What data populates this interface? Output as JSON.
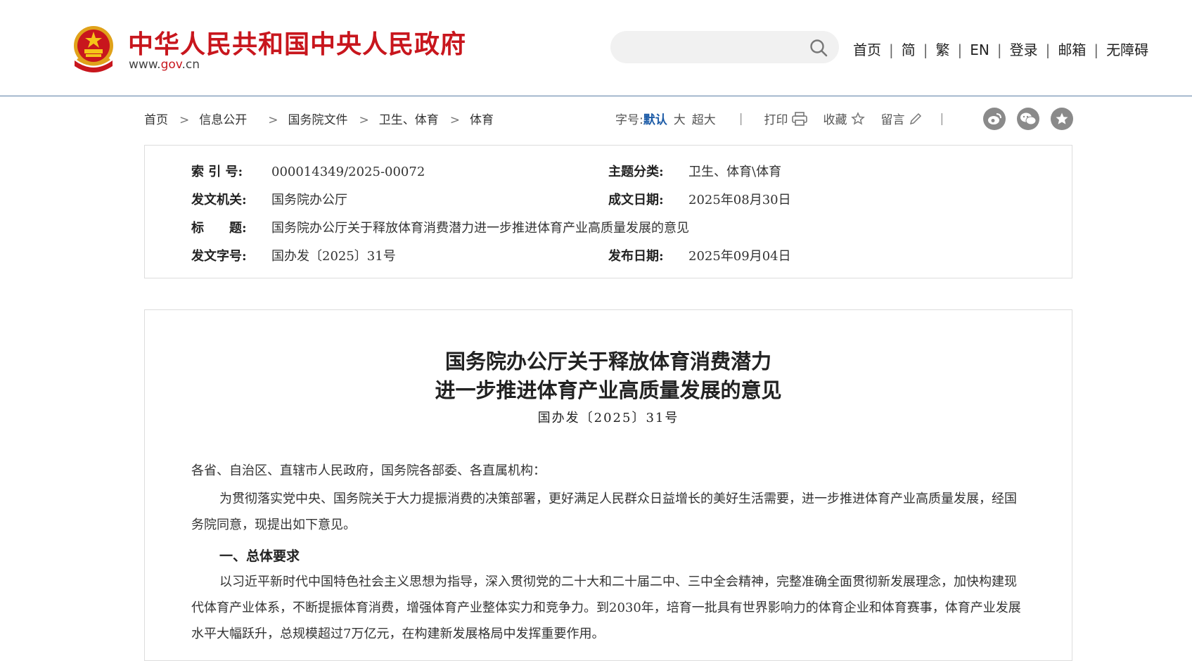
{
  "header": {
    "site_title": "中华人民共和国中央人民政府",
    "url_prefix": "www.",
    "url_gov": "gov",
    "url_suffix": ".cn",
    "search": {
      "placeholder": "",
      "value": "",
      "icon": "search-icon"
    },
    "nav": [
      "首页",
      "简",
      "繁",
      "EN",
      "登录",
      "邮箱",
      "无障碍"
    ]
  },
  "breadcrumb": [
    "首页",
    "信息公开",
    "国务院文件",
    "卫生、体育",
    "体育"
  ],
  "tools": {
    "font_size_label": "字号:",
    "font_sizes": [
      "默认",
      "大",
      "超大"
    ],
    "print_label": "打印",
    "favorite_label": "收藏",
    "comment_label": "留言",
    "share_icons": [
      "weibo-icon",
      "wechat-icon",
      "star-share-icon"
    ]
  },
  "meta": {
    "index_label": "索 引 号:",
    "index_value": "000014349/2025-00072",
    "topic_label": "主题分类:",
    "topic_value": "卫生、体育\\体育",
    "issuer_label": "发文机关:",
    "issuer_value": "国务院办公厅",
    "created_label": "成文日期:",
    "created_value": "2025年08月30日",
    "title_label": "标　　题:",
    "title_value": "国务院办公厅关于释放体育消费潜力进一步推进体育产业高质量发展的意见",
    "docno_label": "发文字号:",
    "docno_value": "国办发〔2025〕31号",
    "published_label": "发布日期:",
    "published_value": "2025年09月04日"
  },
  "article": {
    "title_line1": "国务院办公厅关于释放体育消费潜力",
    "title_line2": "进一步推进体育产业高质量发展的意见",
    "doc_no": "国办发〔2025〕31号",
    "salutation": "各省、自治区、直辖市人民政府，国务院各部委、各直属机构：",
    "intro": "为贯彻落实党中央、国务院关于大力提振消费的决策部署，更好满足人民群众日益增长的美好生活需要，进一步推进体育产业高质量发展，经国务院同意，现提出如下意见。",
    "section1_heading": "一、总体要求",
    "section1_body": "以习近平新时代中国特色社会主义思想为指导，深入贯彻党的二十大和二十届二中、三中全会精神，完整准确全面贯彻新发展理念，加快构建现代体育产业体系，不断提振体育消费，增强体育产业整体实力和竞争力。到2030年，培育一批具有世界影响力的体育企业和体育赛事，体育产业发展水平大幅跃升，总规模超过7万亿元，在构建新发展格局中发挥重要作用。"
  },
  "colors": {
    "brand_red": "#c8161d",
    "accent_blue": "#1c5ba7",
    "header_rule": "#5b7fa6"
  }
}
